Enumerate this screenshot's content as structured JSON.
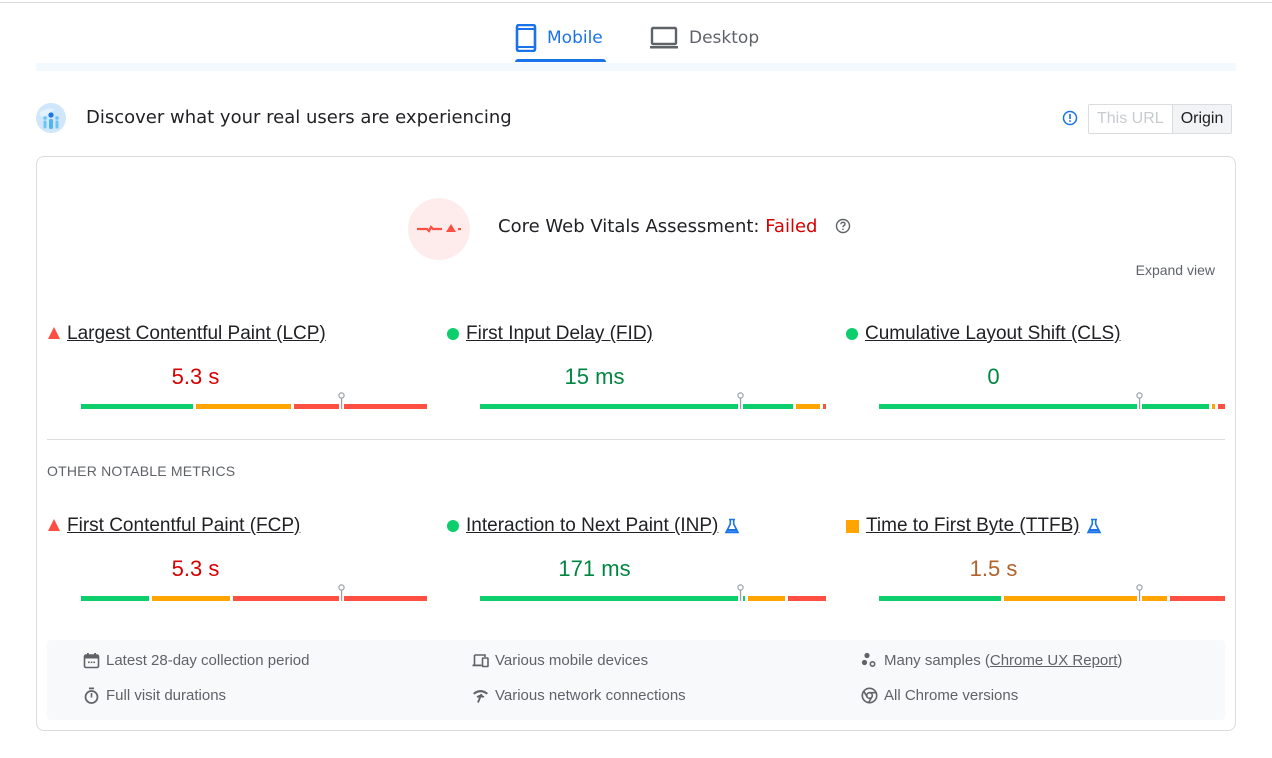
{
  "tabs": [
    {
      "label": "Mobile",
      "icon": "smartphone-icon",
      "active": true
    },
    {
      "label": "Desktop",
      "icon": "laptop-icon",
      "active": false
    }
  ],
  "header": {
    "title": "Discover what your real users are experiencing",
    "toggle": {
      "this_url": "This URL",
      "origin": "Origin",
      "selected": "Origin"
    }
  },
  "assessment": {
    "label": "Core Web Vitals Assessment: ",
    "result": "Failed",
    "expand_label": "Expand view"
  },
  "colors": {
    "good": "#0cce6b",
    "average": "#ffa400",
    "poor": "#ff4e42",
    "accent": "#1a73e8",
    "failed_text": "#d50000"
  },
  "core_metrics": [
    {
      "name": "Largest Contentful Paint (LCP)",
      "value": "5.3 s",
      "status": "fail",
      "value_color": "#d50000",
      "distribution": {
        "good": 0.33,
        "average": 0.28,
        "poor": 0.39
      },
      "marker": 0.75
    },
    {
      "name": "First Input Delay (FID)",
      "value": "15 ms",
      "status": "pass",
      "value_color": "#018642",
      "distribution": {
        "good": 0.92,
        "average": 0.07,
        "poor": 0.01
      },
      "marker": 0.75
    },
    {
      "name": "Cumulative Layout Shift (CLS)",
      "value": "0",
      "status": "pass",
      "value_color": "#018642",
      "distribution": {
        "good": 0.97,
        "average": 0.01,
        "poor": 0.01
      },
      "marker": 0.75
    }
  ],
  "other_label": "OTHER NOTABLE METRICS",
  "other_metrics": [
    {
      "name": "First Contentful Paint (FCP)",
      "value": "5.3 s",
      "status": "fail",
      "value_color": "#d50000",
      "experimental": false,
      "distribution": {
        "good": 0.2,
        "average": 0.23,
        "poor": 0.57
      },
      "marker": 0.75
    },
    {
      "name": "Interaction to Next Paint (INP)",
      "value": "171 ms",
      "status": "pass",
      "value_color": "#018642",
      "experimental": true,
      "distribution": {
        "good": 0.78,
        "average": 0.11,
        "poor": 0.11
      },
      "marker": 0.75
    },
    {
      "name": "Time to First Byte (TTFB)",
      "value": "1.5 s",
      "status": "avg",
      "value_color": "#b1632a",
      "experimental": true,
      "distribution": {
        "good": 0.36,
        "average": 0.48,
        "poor": 0.16
      },
      "marker": 0.75
    }
  ],
  "footer": {
    "items": [
      {
        "icon": "calendar-icon",
        "text": "Latest 28-day collection period"
      },
      {
        "icon": "devices-icon",
        "text": "Various mobile devices"
      },
      {
        "icon": "samples-icon",
        "text_before": "Many samples (",
        "link": "Chrome UX Report",
        "text_after": ")"
      },
      {
        "icon": "stopwatch-icon",
        "text": "Full visit durations"
      },
      {
        "icon": "network-icon",
        "text": "Various network connections"
      },
      {
        "icon": "chrome-icon",
        "text": "All Chrome versions"
      }
    ]
  }
}
